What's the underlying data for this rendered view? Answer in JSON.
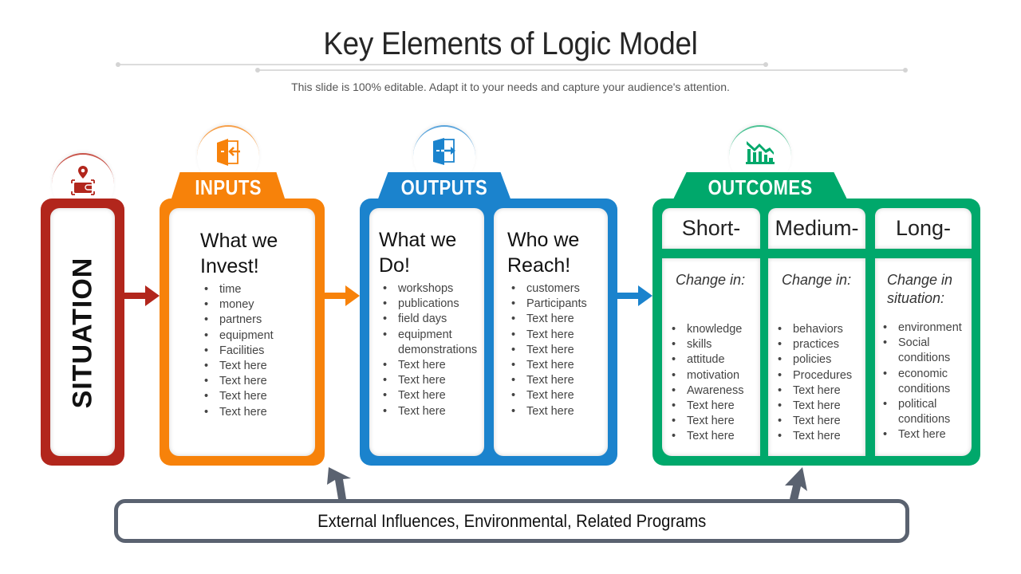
{
  "header": {
    "title": "Key Elements of Logic Model",
    "subtitle": "This slide is 100% editable. Adapt it to your needs and capture your audience's attention."
  },
  "colors": {
    "situation": "#b2261c",
    "inputs": "#f7820a",
    "outputs": "#1b83cd",
    "outcomes": "#00a86b",
    "external": "#5a6270"
  },
  "situation": {
    "label": "SITUATION",
    "icon": "wallet-location-icon"
  },
  "inputs": {
    "tab_label": "INPUTS",
    "icon": "door-enter-icon",
    "heading": "What we Invest!",
    "items": [
      "time",
      "money",
      "partners",
      "equipment",
      "Facilities",
      "Text here",
      "Text here",
      "Text here",
      "Text here"
    ]
  },
  "outputs": {
    "tab_label": "OUTPUTS",
    "icon": "door-exit-icon",
    "columns": [
      {
        "heading": "What we Do!",
        "items": [
          "workshops",
          "publications",
          "field days",
          "equipment demonstrations",
          "Text here",
          "Text here",
          "Text here",
          "Text here"
        ]
      },
      {
        "heading": "Who we Reach!",
        "items": [
          "customers",
          "Participants",
          "Text here",
          "Text here",
          "Text here",
          "Text here",
          "Text here",
          "Text here",
          "Text here"
        ]
      }
    ]
  },
  "outcomes": {
    "tab_label": "OUTCOMES",
    "icon": "chart-decline-icon",
    "columns": [
      {
        "title": "Short-",
        "subheading": "Change in:",
        "items": [
          "knowledge",
          "skills",
          "attitude",
          "motivation",
          "Awareness",
          "Text here",
          "Text here",
          "Text here"
        ]
      },
      {
        "title": "Medium-",
        "subheading": "Change in:",
        "items": [
          "behaviors",
          "practices",
          "policies",
          "Procedures",
          "Text here",
          "Text here",
          "Text here",
          "Text here"
        ]
      },
      {
        "title": "Long-",
        "subheading": "Change in situation:",
        "items": [
          "environment",
          "Social conditions",
          "economic conditions",
          "political conditions",
          "Text here"
        ]
      }
    ]
  },
  "external": {
    "label": "External Influences, Environmental, Related Programs"
  }
}
